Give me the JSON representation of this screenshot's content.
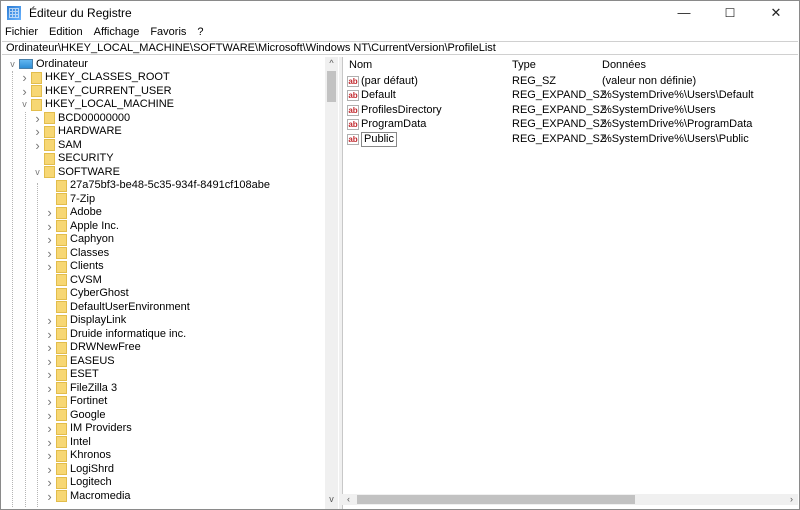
{
  "window": {
    "title": "Éditeur du Registre",
    "minimize": "—",
    "maximize": "☐",
    "close": "✕"
  },
  "menu": [
    "Fichier",
    "Edition",
    "Affichage",
    "Favoris",
    "?"
  ],
  "address": "Ordinateur\\HKEY_LOCAL_MACHINE\\SOFTWARE\\Microsoft\\Windows NT\\CurrentVersion\\ProfileList",
  "tree": [
    {
      "label": "Ordinateur",
      "level": 0,
      "state": "expanded",
      "icon": "computer-icon"
    },
    {
      "label": "HKEY_CLASSES_ROOT",
      "level": 1,
      "state": "collapsed"
    },
    {
      "label": "HKEY_CURRENT_USER",
      "level": 1,
      "state": "collapsed"
    },
    {
      "label": "HKEY_LOCAL_MACHINE",
      "level": 1,
      "state": "expanded"
    },
    {
      "label": "BCD00000000",
      "level": 2,
      "state": "collapsed"
    },
    {
      "label": "HARDWARE",
      "level": 2,
      "state": "collapsed"
    },
    {
      "label": "SAM",
      "level": 2,
      "state": "collapsed"
    },
    {
      "label": "SECURITY",
      "level": 2,
      "state": "leaf"
    },
    {
      "label": "SOFTWARE",
      "level": 2,
      "state": "expanded"
    },
    {
      "label": "27a75bf3-be48-5c35-934f-8491cf108abe",
      "level": 3,
      "state": "leaf"
    },
    {
      "label": "7-Zip",
      "level": 3,
      "state": "leaf"
    },
    {
      "label": "Adobe",
      "level": 3,
      "state": "collapsed"
    },
    {
      "label": "Apple Inc.",
      "level": 3,
      "state": "collapsed"
    },
    {
      "label": "Caphyon",
      "level": 3,
      "state": "collapsed"
    },
    {
      "label": "Classes",
      "level": 3,
      "state": "collapsed"
    },
    {
      "label": "Clients",
      "level": 3,
      "state": "collapsed"
    },
    {
      "label": "CVSM",
      "level": 3,
      "state": "leaf"
    },
    {
      "label": "CyberGhost",
      "level": 3,
      "state": "leaf"
    },
    {
      "label": "DefaultUserEnvironment",
      "level": 3,
      "state": "leaf"
    },
    {
      "label": "DisplayLink",
      "level": 3,
      "state": "collapsed"
    },
    {
      "label": "Druide informatique inc.",
      "level": 3,
      "state": "collapsed"
    },
    {
      "label": "DRWNewFree",
      "level": 3,
      "state": "collapsed"
    },
    {
      "label": "EASEUS",
      "level": 3,
      "state": "collapsed"
    },
    {
      "label": "ESET",
      "level": 3,
      "state": "collapsed"
    },
    {
      "label": "FileZilla 3",
      "level": 3,
      "state": "collapsed"
    },
    {
      "label": "Fortinet",
      "level": 3,
      "state": "collapsed"
    },
    {
      "label": "Google",
      "level": 3,
      "state": "collapsed"
    },
    {
      "label": "IM Providers",
      "level": 3,
      "state": "collapsed"
    },
    {
      "label": "Intel",
      "level": 3,
      "state": "collapsed"
    },
    {
      "label": "Khronos",
      "level": 3,
      "state": "collapsed"
    },
    {
      "label": "LogiShrd",
      "level": 3,
      "state": "collapsed"
    },
    {
      "label": "Logitech",
      "level": 3,
      "state": "collapsed"
    },
    {
      "label": "Macromedia",
      "level": 3,
      "state": "collapsed"
    }
  ],
  "list": {
    "columns": [
      "Nom",
      "Type",
      "Données"
    ],
    "rows": [
      {
        "name": "(par défaut)",
        "type": "REG_SZ",
        "data": "(valeur non définie)"
      },
      {
        "name": "Default",
        "type": "REG_EXPAND_SZ",
        "data": "%SystemDrive%\\Users\\Default"
      },
      {
        "name": "ProfilesDirectory",
        "type": "REG_EXPAND_SZ",
        "data": "%SystemDrive%\\Users"
      },
      {
        "name": "ProgramData",
        "type": "REG_EXPAND_SZ",
        "data": "%SystemDrive%\\ProgramData"
      },
      {
        "name": "Public",
        "type": "REG_EXPAND_SZ",
        "data": "%SystemDrive%\\Users\\Public",
        "editing": true
      }
    ],
    "value_icon": "ab"
  }
}
